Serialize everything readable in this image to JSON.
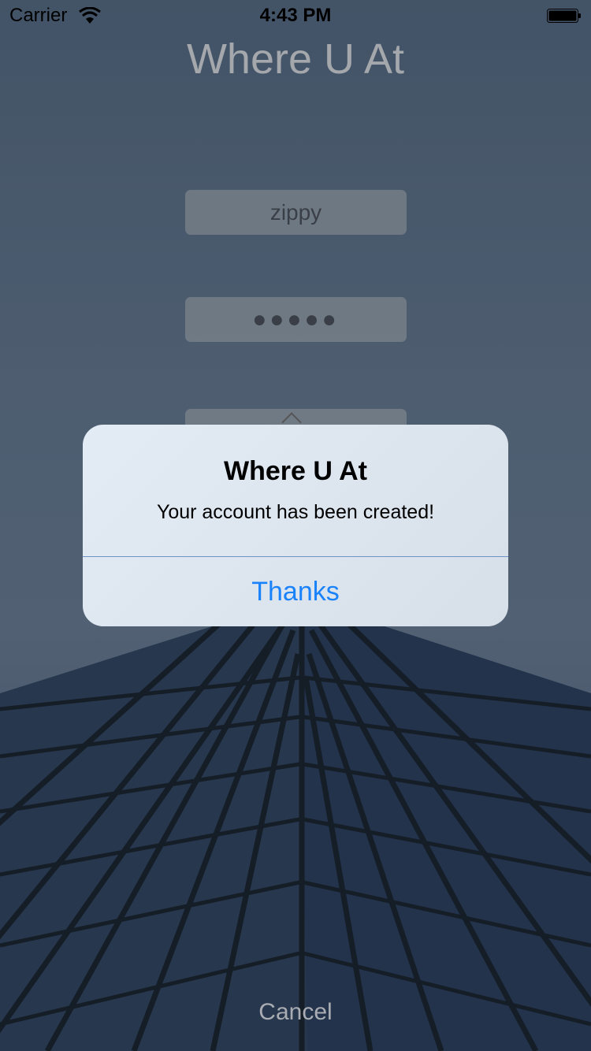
{
  "status_bar": {
    "carrier": "Carrier",
    "time": "4:43 PM"
  },
  "app": {
    "title": "Where U At"
  },
  "form": {
    "username_value": "zippy",
    "password_masked": "●●●●●"
  },
  "alert": {
    "title": "Where U At",
    "message": "Your account has been created!",
    "button_label": "Thanks"
  },
  "footer": {
    "cancel_label": "Cancel"
  },
  "colors": {
    "accent": "#1a82fb",
    "alert_divider": "#6f93c6"
  }
}
